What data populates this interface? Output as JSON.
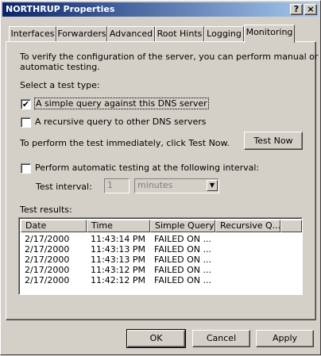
{
  "window": {
    "title": "NORTHRUP Properties",
    "help_button": "?",
    "close_button": "×"
  },
  "tabs": [
    {
      "label": "Interfaces",
      "active": false
    },
    {
      "label": "Forwarders",
      "active": false
    },
    {
      "label": "Advanced",
      "active": false
    },
    {
      "label": "Root Hints",
      "active": false
    },
    {
      "label": "Logging",
      "active": false
    },
    {
      "label": "Monitoring",
      "active": true
    }
  ],
  "monitoring": {
    "intro": "To verify the configuration of the server, you can perform manual or",
    "intro2": "automatic testing.",
    "select_label": "Select a test type:",
    "simple_query": {
      "label": "A simple query against this DNS server",
      "checked": true
    },
    "recursive_query": {
      "label": "A recursive query to other DNS servers",
      "checked": false
    },
    "test_now_text": "To perform the test immediately, click Test Now.",
    "test_now_button": "Test Now",
    "auto_test": {
      "label": "Perform automatic testing at the following interval:",
      "checked": false
    },
    "interval_label": "Test interval:",
    "interval_value": "1",
    "interval_unit": "minutes",
    "results_label": "Test results:",
    "results": {
      "columns": [
        "Date",
        "Time",
        "Simple Query",
        "Recursive Q..."
      ],
      "rows": [
        [
          "2/17/2000",
          "11:43:14 PM",
          "FAILED ON ...",
          ""
        ],
        [
          "2/17/2000",
          "11:43:13 PM",
          "FAILED ON ...",
          ""
        ],
        [
          "2/17/2000",
          "11:43:13 PM",
          "FAILED ON ...",
          ""
        ],
        [
          "2/17/2000",
          "11:43:12 PM",
          "FAILED ON ...",
          ""
        ],
        [
          "2/17/2000",
          "11:42:12 PM",
          "FAILED ON ...",
          ""
        ]
      ]
    }
  },
  "footer": {
    "ok": "OK",
    "cancel": "Cancel",
    "apply": "Apply"
  }
}
